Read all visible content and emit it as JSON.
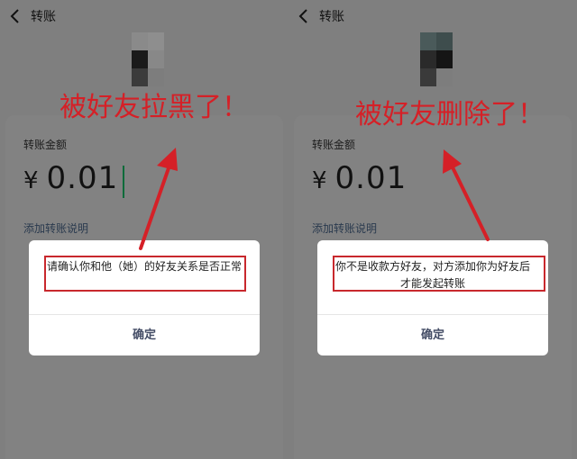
{
  "panels": [
    {
      "nav_title": "转账",
      "amount_label": "转账金额",
      "currency_symbol": "¥",
      "amount": "0.01",
      "remark_link": "添加转账说明",
      "dialog": {
        "message": "请确认你和他（她）的好友关系是否正常",
        "confirm": "确定"
      },
      "annotation": "被好友拉黑了！"
    },
    {
      "nav_title": "转账",
      "amount_label": "转账金额",
      "currency_symbol": "¥",
      "amount": "0.01",
      "remark_link": "添加转账说明",
      "dialog": {
        "message": "你不是收款方好友，对方添加你为好友后才能发起转账",
        "confirm": "确定"
      },
      "annotation": "被好友删除了！"
    }
  ],
  "icons": {
    "back": "chevron-left-icon"
  },
  "colors": {
    "overlay": "#7f7f7f",
    "annotation": "#d52027",
    "caret": "#0b6b3a"
  }
}
